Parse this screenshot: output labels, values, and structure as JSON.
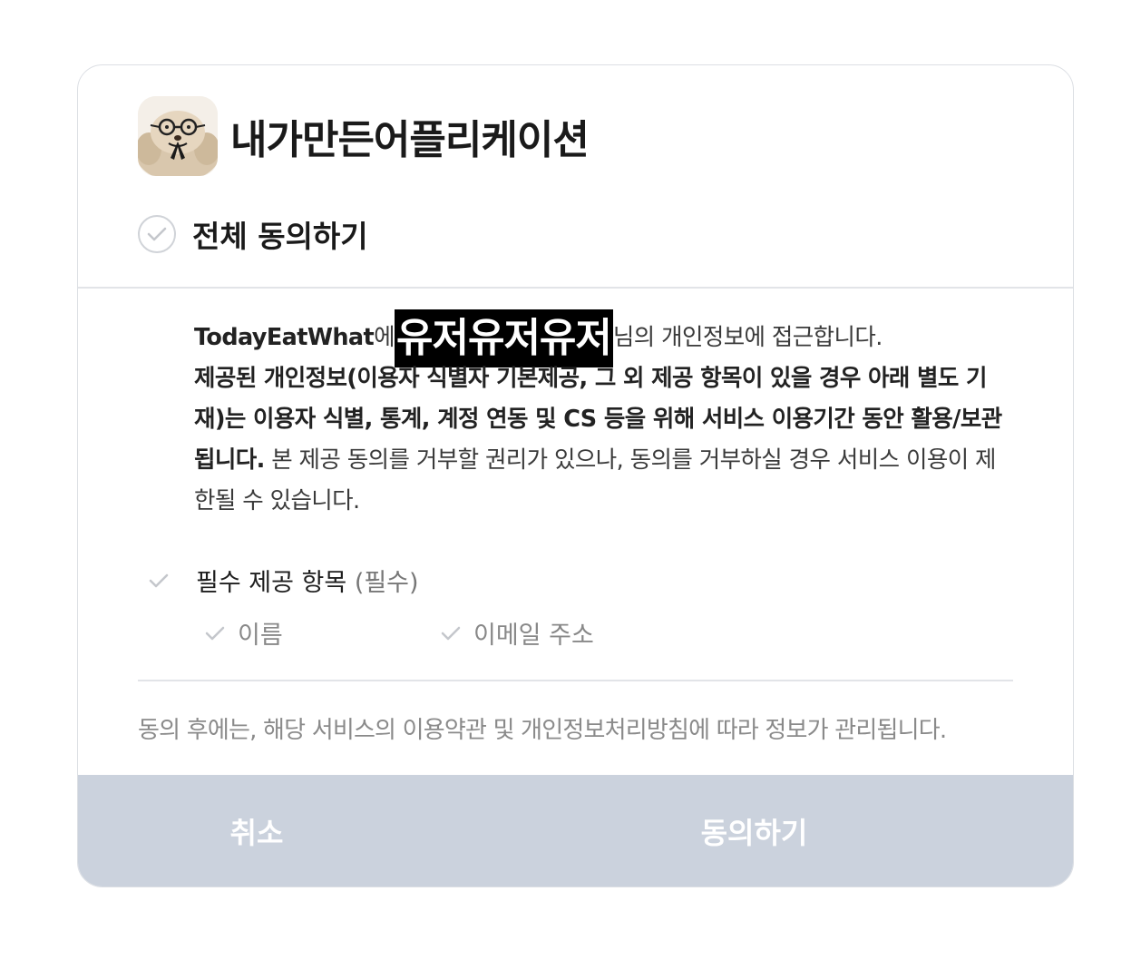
{
  "app": {
    "title": "내가만든어플리케이션",
    "icon": "bear-with-glasses-icon"
  },
  "agree_all": {
    "label": "전체 동의하기",
    "checked": false
  },
  "description": {
    "app_name": "TodayEatWhat",
    "particle": "에",
    "redacted_user": "유저유저유저",
    "line1_rest": "님의 개인정보에 접근합니다.",
    "bold_text": "제공된 개인정보(이용자 식별자 기본제공, 그 외 제공 항목이 있을 경우 아래 별도 기재)는 이용자 식별, 통계, 계정 연동 및 CS 등을 위해 서비스 이용기간 동안 활용/보관 됩니다.",
    "normal_text": "본 제공 동의를 거부할 권리가 있으나, 동의를 거부하실 경우 서비스 이용이 제한될 수 있습니다."
  },
  "required": {
    "label": "필수 제공 항목",
    "tag": "(필수)",
    "items": [
      {
        "label": "이름"
      },
      {
        "label": "이메일 주소"
      }
    ]
  },
  "footnote": "동의 후에는, 해당 서비스의 이용약관 및 개인정보처리방침에 따라 정보가 관리됩니다.",
  "buttons": {
    "cancel": "취소",
    "agree": "동의하기"
  },
  "colors": {
    "button_bar": "#cbd2dd",
    "check_gray": "#c4c7cc"
  }
}
